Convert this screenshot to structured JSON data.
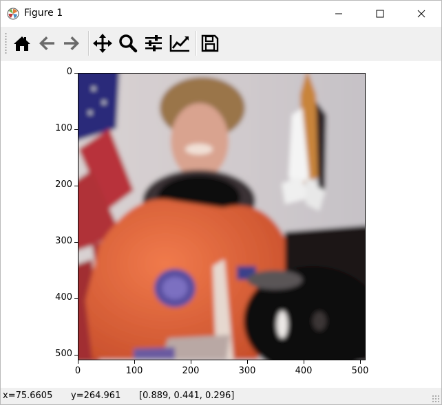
{
  "window": {
    "title": "Figure 1",
    "app_icon": "matplotlib-logo-icon",
    "controls": [
      "minimize-icon",
      "maximize-icon",
      "close-icon"
    ]
  },
  "toolbar": {
    "buttons": [
      {
        "name": "home",
        "icon": "home-icon"
      },
      {
        "name": "back",
        "icon": "arrow-left-icon"
      },
      {
        "name": "forward",
        "icon": "arrow-right-icon"
      },
      {
        "name": "pan",
        "icon": "move-arrows-icon"
      },
      {
        "name": "zoom",
        "icon": "magnifier-icon"
      },
      {
        "name": "configure-subplots",
        "icon": "sliders-icon"
      },
      {
        "name": "edit-axis",
        "icon": "line-chart-icon"
      },
      {
        "name": "save",
        "icon": "floppy-disk-icon"
      }
    ]
  },
  "plot": {
    "image_description_icon": "astronaut-photo",
    "x_ticks": [
      "0",
      "100",
      "200",
      "300",
      "400",
      "500"
    ],
    "y_ticks": [
      "0",
      "100",
      "200",
      "300",
      "400",
      "500"
    ]
  },
  "status": {
    "x": "x=75.6605",
    "y": "y=264.961",
    "rgb": "[0.889, 0.441, 0.296]"
  },
  "colors": {
    "toolbar_bg": "#f0f0f0",
    "suit_orange": "#e8693e",
    "flag_blue": "#2b2a7a",
    "flag_red": "#b8323a"
  }
}
